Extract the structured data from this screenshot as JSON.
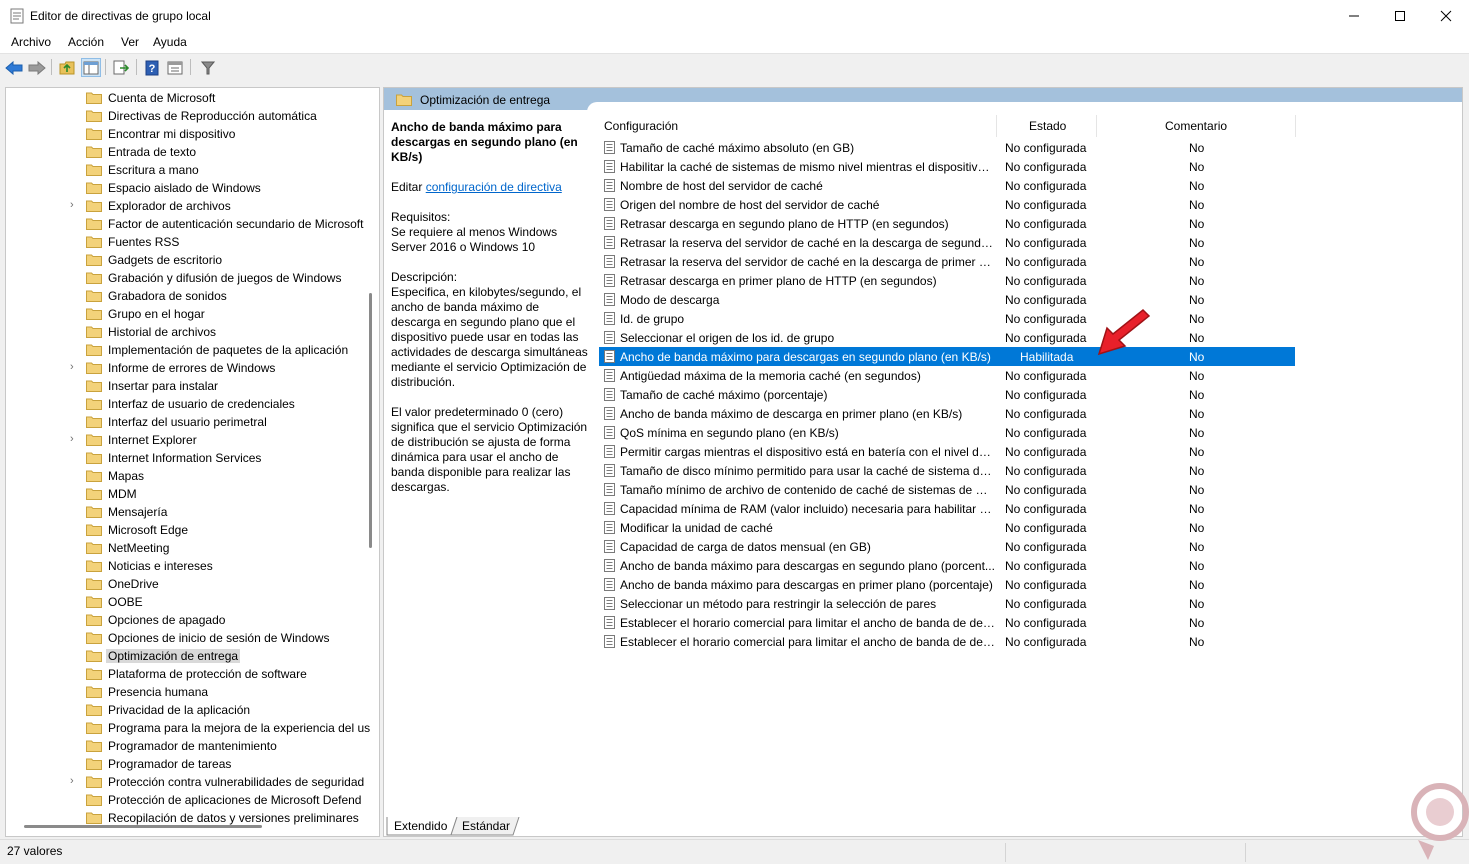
{
  "window": {
    "title": "Editor de directivas de grupo local"
  },
  "menu": [
    "Archivo",
    "Acción",
    "Ver",
    "Ayuda"
  ],
  "tree": {
    "items": [
      {
        "label": "Cuenta de Microsoft",
        "expandable": false
      },
      {
        "label": "Directivas de Reproducción automática",
        "expandable": false
      },
      {
        "label": "Encontrar mi dispositivo",
        "expandable": false
      },
      {
        "label": "Entrada de texto",
        "expandable": false
      },
      {
        "label": "Escritura a mano",
        "expandable": false
      },
      {
        "label": "Espacio aislado de Windows",
        "expandable": false
      },
      {
        "label": "Explorador de archivos",
        "expandable": true
      },
      {
        "label": "Factor de autenticación secundario de Microsoft",
        "expandable": false
      },
      {
        "label": "Fuentes RSS",
        "expandable": false
      },
      {
        "label": "Gadgets de escritorio",
        "expandable": false
      },
      {
        "label": "Grabación y difusión de juegos de Windows",
        "expandable": false
      },
      {
        "label": "Grabadora de sonidos",
        "expandable": false
      },
      {
        "label": "Grupo en el hogar",
        "expandable": false
      },
      {
        "label": "Historial de archivos",
        "expandable": false
      },
      {
        "label": "Implementación de paquetes de la aplicación",
        "expandable": false
      },
      {
        "label": "Informe de errores de Windows",
        "expandable": true
      },
      {
        "label": "Insertar para instalar",
        "expandable": false
      },
      {
        "label": "Interfaz de usuario de credenciales",
        "expandable": false
      },
      {
        "label": "Interfaz del usuario perimetral",
        "expandable": false
      },
      {
        "label": "Internet Explorer",
        "expandable": true
      },
      {
        "label": "Internet Information Services",
        "expandable": false
      },
      {
        "label": "Mapas",
        "expandable": false
      },
      {
        "label": "MDM",
        "expandable": false
      },
      {
        "label": "Mensajería",
        "expandable": false
      },
      {
        "label": "Microsoft Edge",
        "expandable": false
      },
      {
        "label": "NetMeeting",
        "expandable": false
      },
      {
        "label": "Noticias e intereses",
        "expandable": false
      },
      {
        "label": "OneDrive",
        "expandable": false
      },
      {
        "label": "OOBE",
        "expandable": false
      },
      {
        "label": "Opciones de apagado",
        "expandable": false
      },
      {
        "label": "Opciones de inicio de sesión de Windows",
        "expandable": false
      },
      {
        "label": "Optimización de entrega",
        "expandable": false,
        "selected": true
      },
      {
        "label": "Plataforma de protección de software",
        "expandable": false
      },
      {
        "label": "Presencia humana",
        "expandable": false
      },
      {
        "label": "Privacidad de la aplicación",
        "expandable": false
      },
      {
        "label": "Programa para la mejora de la experiencia del us",
        "expandable": false
      },
      {
        "label": "Programador de mantenimiento",
        "expandable": false
      },
      {
        "label": "Programador de tareas",
        "expandable": false
      },
      {
        "label": "Protección contra vulnerabilidades de seguridad",
        "expandable": true
      },
      {
        "label": "Protección de aplicaciones de Microsoft Defend",
        "expandable": false
      },
      {
        "label": "Recopilación de datos y versiones preliminares",
        "expandable": false
      }
    ]
  },
  "right": {
    "header": "Optimización de entrega",
    "description": {
      "title": "Ancho de banda máximo para descargas en segundo plano (en KB/s)",
      "edit_prefix": "Editar",
      "edit_link": "configuración de directiva",
      "requirements": "Requisitos:\nSe requiere al menos Windows Server 2016 o Windows 10",
      "description": "Descripción:\nEspecifica, en kilobytes/segundo, el ancho de banda máximo de descarga en segundo plano que el dispositivo puede usar en todas las actividades de descarga simultáneas mediante el servicio Optimización de distribución.",
      "default_value": "El valor predeterminado 0 (cero) significa que el servicio Optimización de distribución se ajusta de forma dinámica para usar el ancho de banda disponible para realizar las descargas."
    },
    "columns": {
      "name": "Configuración",
      "state": "Estado",
      "comment": "Comentario"
    },
    "rows": [
      {
        "name": "Tamaño de caché máximo absoluto (en GB)",
        "state": "No configurada",
        "comment": "No"
      },
      {
        "name": "Habilitar la caché de sistemas de mismo nivel mientras el dispositivo ...",
        "state": "No configurada",
        "comment": "No"
      },
      {
        "name": "Nombre de host del servidor de caché",
        "state": "No configurada",
        "comment": "No"
      },
      {
        "name": "Origen del nombre de host del servidor de caché",
        "state": "No configurada",
        "comment": "No"
      },
      {
        "name": "Retrasar descarga en segundo plano de HTTP (en segundos)",
        "state": "No configurada",
        "comment": "No"
      },
      {
        "name": "Retrasar la reserva del servidor de caché en la descarga de segundo pl...",
        "state": "No configurada",
        "comment": "No"
      },
      {
        "name": "Retrasar la reserva del servidor de caché en la descarga de primer plan...",
        "state": "No configurada",
        "comment": "No"
      },
      {
        "name": "Retrasar descarga en primer plano de HTTP (en segundos)",
        "state": "No configurada",
        "comment": "No"
      },
      {
        "name": "Modo de descarga",
        "state": "No configurada",
        "comment": "No"
      },
      {
        "name": "Id. de grupo",
        "state": "No configurada",
        "comment": "No"
      },
      {
        "name": "Seleccionar el origen de los id. de grupo",
        "state": "No configurada",
        "comment": "No"
      },
      {
        "name": "Ancho de banda máximo para descargas en segundo plano (en KB/s)",
        "state": "Habilitada",
        "comment": "No",
        "selected": true
      },
      {
        "name": "Antigüedad máxima de la memoria caché (en segundos)",
        "state": "No configurada",
        "comment": "No"
      },
      {
        "name": "Tamaño de caché máximo (porcentaje)",
        "state": "No configurada",
        "comment": "No"
      },
      {
        "name": "Ancho de banda máximo de descarga en primer plano (en KB/s)",
        "state": "No configurada",
        "comment": "No"
      },
      {
        "name": "QoS mínima en segundo plano (en KB/s)",
        "state": "No configurada",
        "comment": "No"
      },
      {
        "name": "Permitir cargas mientras el dispositivo está en batería con el nivel de ...",
        "state": "No configurada",
        "comment": "No"
      },
      {
        "name": "Tamaño de disco mínimo permitido para usar la caché de sistema de ...",
        "state": "No configurada",
        "comment": "No"
      },
      {
        "name": "Tamaño mínimo de archivo de contenido de caché de sistemas de mi...",
        "state": "No configurada",
        "comment": "No"
      },
      {
        "name": "Capacidad mínima de RAM (valor incluido) necesaria para habilitar el...",
        "state": "No configurada",
        "comment": "No"
      },
      {
        "name": "Modificar la unidad de caché",
        "state": "No configurada",
        "comment": "No"
      },
      {
        "name": "Capacidad de carga de datos mensual (en GB)",
        "state": "No configurada",
        "comment": "No"
      },
      {
        "name": "Ancho de banda máximo para descargas en segundo plano (porcent...",
        "state": "No configurada",
        "comment": "No"
      },
      {
        "name": "Ancho de banda máximo para descargas en primer plano (porcentaje)",
        "state": "No configurada",
        "comment": "No"
      },
      {
        "name": "Seleccionar un método para restringir la selección de pares",
        "state": "No configurada",
        "comment": "No"
      },
      {
        "name": "Establecer el horario comercial para limitar el ancho de banda de des...",
        "state": "No configurada",
        "comment": "No"
      },
      {
        "name": "Establecer el horario comercial para limitar el ancho de banda de des...",
        "state": "No configurada",
        "comment": "No"
      }
    ]
  },
  "tabs": [
    "Extendido",
    "Estándar"
  ],
  "status": {
    "text": "27 valores"
  },
  "colors": {
    "selection": "#0078d7",
    "header_band": "#a4c1dc",
    "link": "#0066cc",
    "arrow": "#e8202a"
  },
  "icons": [
    "app-icon",
    "back-arrow-icon",
    "forward-arrow-icon",
    "folder-up-icon",
    "show-hide-tree-icon",
    "export-list-icon",
    "help-icon",
    "properties-icon",
    "filter-icon",
    "folder-icon",
    "policy-setting-icon",
    "minimize-icon",
    "maximize-icon",
    "close-icon"
  ]
}
